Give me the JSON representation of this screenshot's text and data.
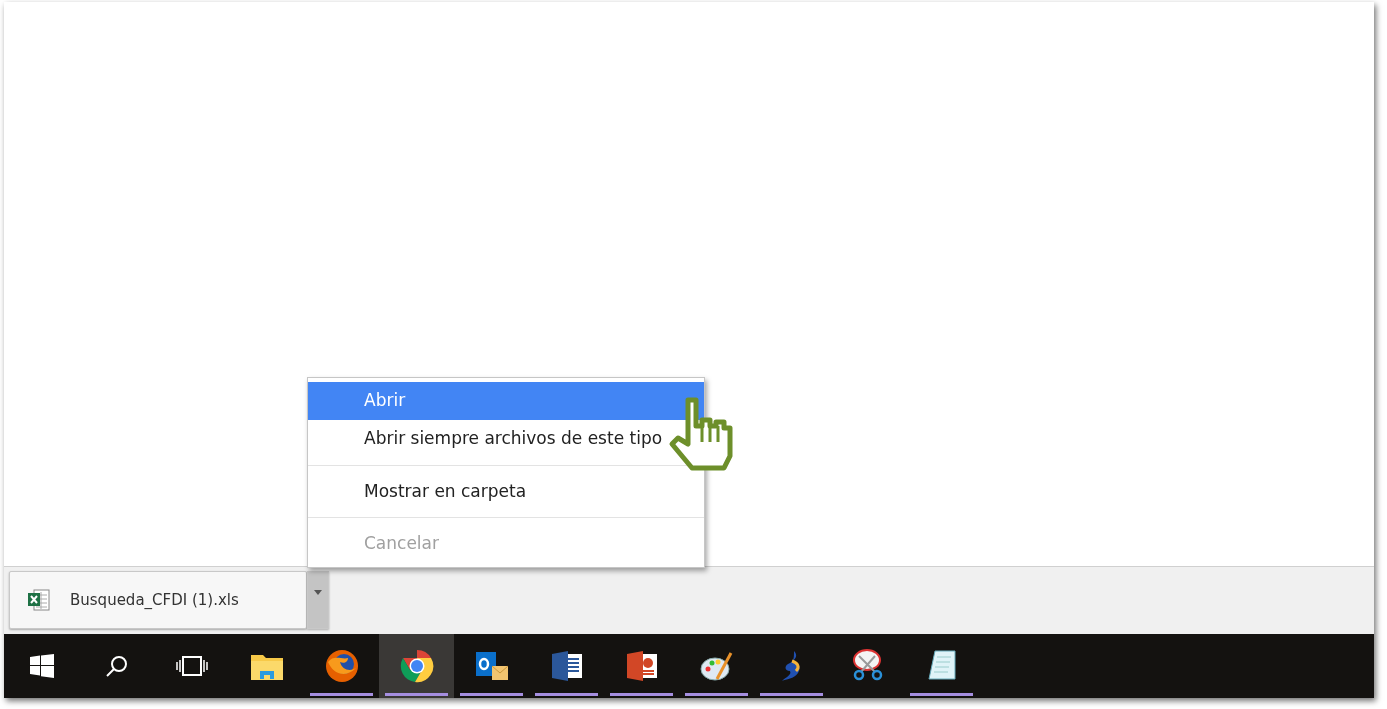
{
  "context_menu": {
    "items": [
      {
        "label": "Abrir",
        "selected": true,
        "disabled": false,
        "divider_after": false
      },
      {
        "label": "Abrir siempre archivos de este tipo",
        "selected": false,
        "disabled": false,
        "divider_after": true
      },
      {
        "label": "Mostrar en carpeta",
        "selected": false,
        "disabled": false,
        "divider_after": true
      },
      {
        "label": "Cancelar",
        "selected": false,
        "disabled": true,
        "divider_after": false
      }
    ]
  },
  "download_shelf": {
    "items": [
      {
        "filename": "Busqueda_CFDI (1).xls",
        "menu_open": true
      }
    ]
  },
  "taskbar": {
    "apps": [
      {
        "running": false,
        "active": false
      },
      {
        "running": true,
        "active": false
      },
      {
        "running": true,
        "active": true
      },
      {
        "running": true,
        "active": false
      },
      {
        "running": true,
        "active": false
      },
      {
        "running": true,
        "active": false
      },
      {
        "running": true,
        "active": false
      },
      {
        "running": true,
        "active": false
      },
      {
        "running": false,
        "active": false
      },
      {
        "running": true,
        "active": false
      }
    ]
  }
}
